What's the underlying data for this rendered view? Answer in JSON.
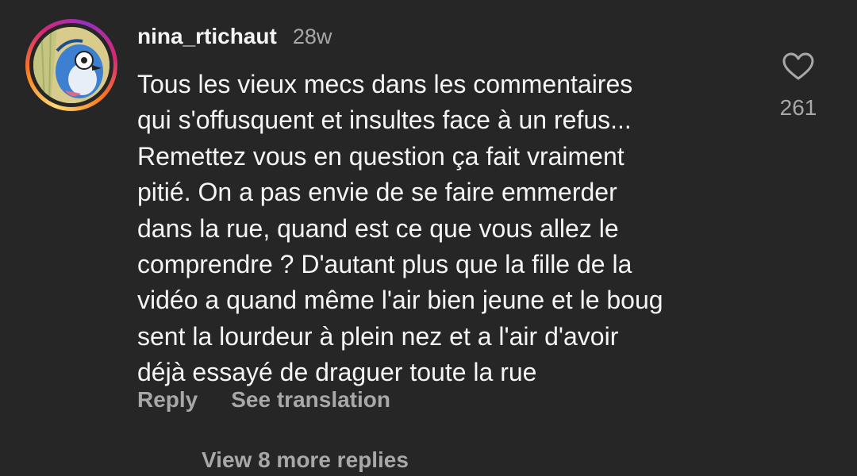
{
  "comment": {
    "username": "nina_rtichaut",
    "time": "28w",
    "text_lines": [
      "Tous les vieux mecs dans les commentaires",
      "qui s'offusquent et insultes face à un refus...",
      "Remettez vous en question ça fait vraiment",
      "pitié. On a pas envie de se faire emmerder",
      "dans la rue, quand est ce que vous allez le",
      "comprendre ? D'autant plus que la fille de la",
      "vidéo a quand même l'air bien jeune et le boug",
      "sent la lourdeur à plein nez et a l'air d'avoir",
      "déjà essayé de draguer toute la rue"
    ],
    "actions": {
      "reply_label": "Reply",
      "translate_label": "See translation"
    },
    "likes": "261",
    "view_more_label": "View 8 more replies"
  },
  "icons": {
    "like": "heart-outline-icon",
    "avatar": "bird-illustration-avatar"
  },
  "colors": {
    "background": "#262626",
    "primary_text": "#f5f5f5",
    "secondary_text": "#a8a8a8",
    "story_ring": [
      "#feda75",
      "#fa7e1e",
      "#d62976",
      "#962fbf"
    ]
  }
}
